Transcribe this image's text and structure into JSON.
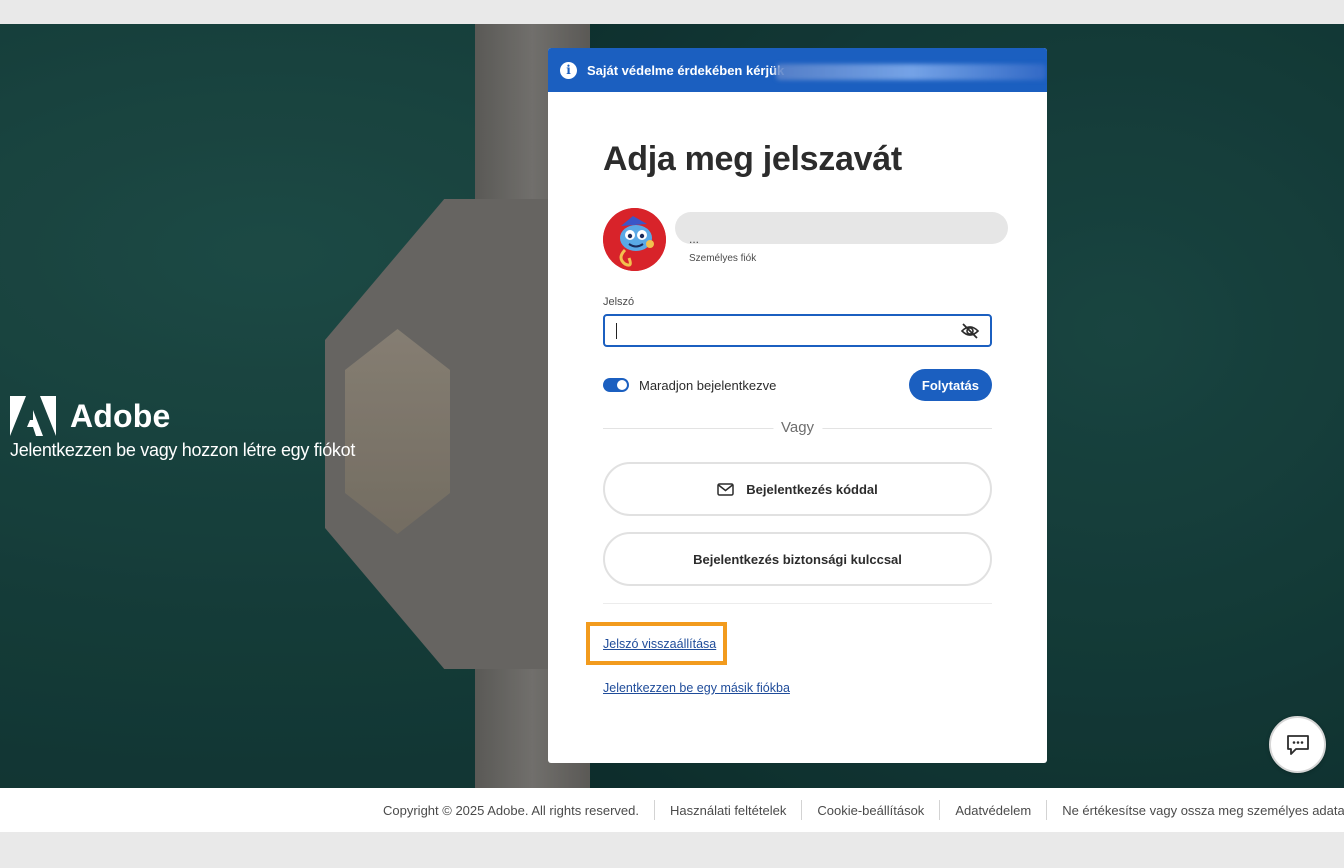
{
  "brand": {
    "name": "Adobe",
    "tagline": "Jelentkezzen be vagy hozzon létre egy fiókot"
  },
  "banner": {
    "text": "Saját védelme érdekében kérjük"
  },
  "login": {
    "title": "Adja meg jelszavát",
    "account_ellipsis": "...",
    "account_type": "Személyes fiók",
    "password_label": "Jelszó",
    "password_value": "",
    "stay_signed_in_label": "Maradjon bejelentkezve",
    "stay_signed_in": true,
    "continue_label": "Folytatás",
    "divider": "Vagy",
    "code_button_label": "Bejelentkezés kóddal",
    "security_key_button_label": "Bejelentkezés biztonsági kulccsal",
    "reset_password_link": "Jelszó visszaállítása",
    "other_account_link": "Jelentkezzen be egy másik fiókba"
  },
  "footer": {
    "copyright": "Copyright © 2025 Adobe. All rights reserved.",
    "terms": "Használati feltételek",
    "cookies": "Cookie-beállítások",
    "privacy": "Adatvédelem",
    "do_not_sell": "Ne értékesítse vagy ossza meg személyes adataimat"
  },
  "colors": {
    "accent": "#1b5fc0",
    "highlight": "#f29b1d"
  }
}
